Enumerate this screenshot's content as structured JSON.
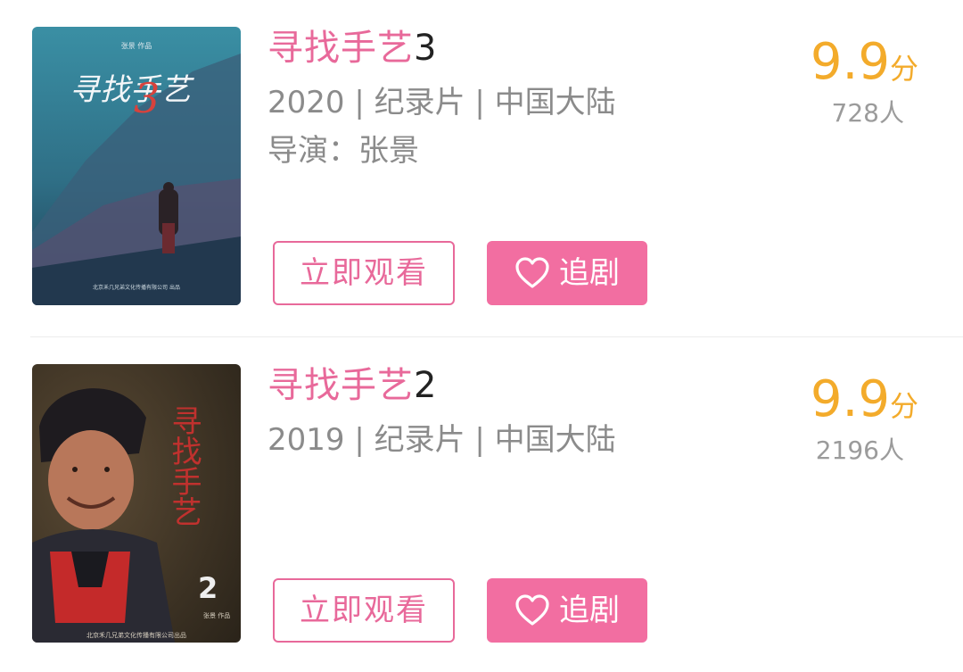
{
  "items": [
    {
      "title_main": "寻找手艺",
      "title_num": "3",
      "meta": "2020 | 纪录片 | 中国大陆",
      "director": "导演：张景",
      "score_num": "9.9",
      "score_unit": "分",
      "count": "728人",
      "watch_label": "立即观看",
      "follow_label": "追剧",
      "poster": {
        "credit_top": "张景 作品",
        "title_art": "寻找手艺",
        "num_art": "3",
        "footer": "北京禾几兄弟文化传播有限公司 出品",
        "icon": "documentary-poster-mountain"
      }
    },
    {
      "title_main": "寻找手艺",
      "title_num": "2",
      "meta": "2019 | 纪录片 | 中国大陆",
      "score_num": "9.9",
      "score_unit": "分",
      "count": "2196人",
      "watch_label": "立即观看",
      "follow_label": "追剧",
      "poster": {
        "title_art": "寻找手艺",
        "num_art": "2",
        "credit": "张景 作品",
        "footer": "北京禾几兄弟文化传播有限公司出品",
        "icon": "documentary-poster-portrait"
      }
    }
  ],
  "colors": {
    "accent_pink": "#e8699a",
    "button_pink": "#f26ea1",
    "score_orange": "#f3ab2b",
    "meta_gray": "#8b8b8b"
  }
}
